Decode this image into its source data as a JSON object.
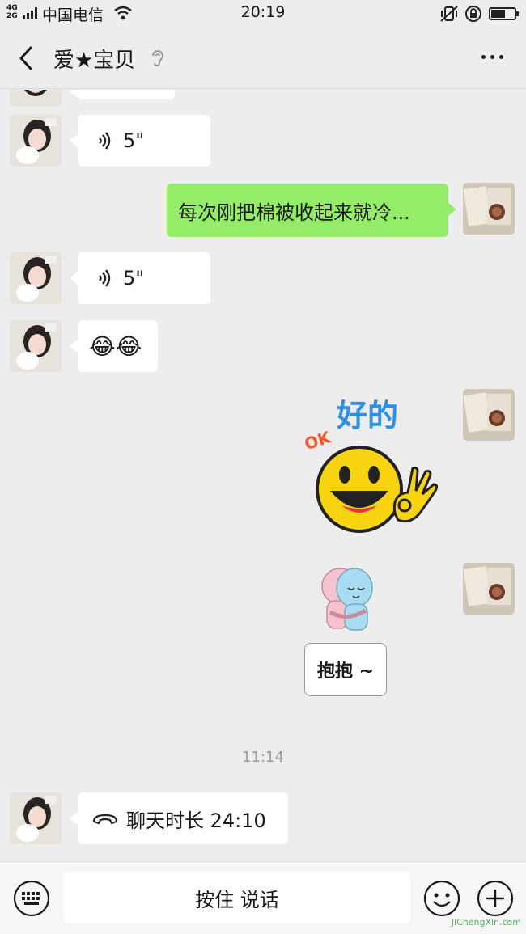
{
  "status_bar": {
    "network": "4G\n2G",
    "carrier": "中国电信",
    "time": "20:19",
    "battery_level": 0.62
  },
  "header": {
    "title": "爱★宝贝"
  },
  "messages": {
    "voice1_duration": "5\"",
    "text1": "每次刚把棉被收起来就冷...",
    "voice2_duration": "5\"",
    "emoji_message": "😂😂",
    "sticker_ok_text": "好的",
    "sticker_ok_badge": "OK",
    "sticker_hug_text": "抱抱 ~",
    "timestamp": "11:14",
    "call_record": "聊天时长 24:10"
  },
  "input_bar": {
    "hold_to_talk": "按住 说话"
  },
  "watermark": "JiChengXin.com",
  "colors": {
    "background": "#ededed",
    "outgoing_bubble": "#95ec69",
    "incoming_bubble": "#ffffff"
  }
}
